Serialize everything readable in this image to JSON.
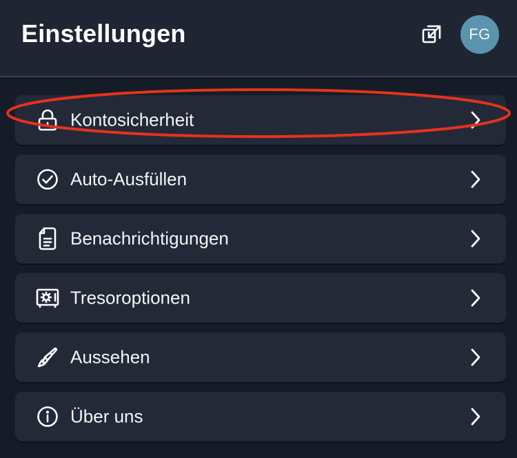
{
  "header": {
    "title": "Einstellungen",
    "popout_icon": "popout-icon",
    "avatar_initials": "FG"
  },
  "menu": {
    "items": [
      {
        "label": "Kontosicherheit",
        "icon": "lock-icon"
      },
      {
        "label": "Auto-Ausfüllen",
        "icon": "check-circle-icon"
      },
      {
        "label": "Benachrichtigungen",
        "icon": "document-icon"
      },
      {
        "label": "Tresoroptionen",
        "icon": "vault-icon"
      },
      {
        "label": "Aussehen",
        "icon": "paintbrush-icon"
      },
      {
        "label": "Über uns",
        "icon": "info-icon"
      }
    ]
  },
  "colors": {
    "background": "#161c27",
    "header": "#1f2533",
    "card": "#232937",
    "avatar": "#5a94ad",
    "annotation": "#e8311e"
  }
}
